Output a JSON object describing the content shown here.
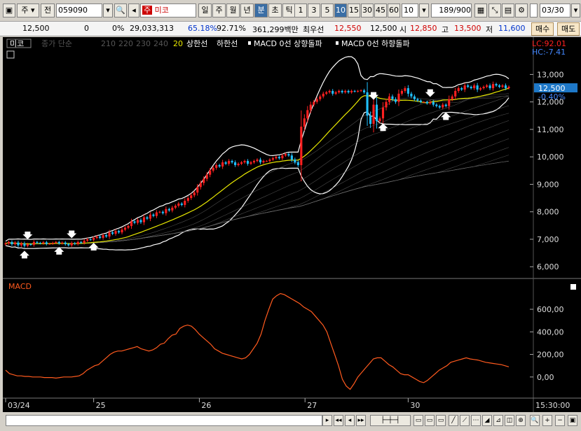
{
  "toolbar": {
    "market": "주",
    "prev_label": "전",
    "code": "059090",
    "name": "미코",
    "periods": [
      "일",
      "주",
      "월",
      "년",
      "분",
      "초",
      "틱"
    ],
    "active_period": "분",
    "intervals": [
      "1",
      "3",
      "5",
      "10",
      "15",
      "30",
      "45",
      "60"
    ],
    "active_interval": "10",
    "interval_value": "10",
    "count_value": "189",
    "count_total": "/900",
    "date": "03/30"
  },
  "quote": {
    "price": "12,500",
    "change": "0",
    "change_pct": "0%",
    "volume": "29,033,313",
    "ratio1": "65.18%",
    "ratio2": "92.71%",
    "amount": "361,299백만",
    "priority_label": "최우선",
    "priority_value": "12,550",
    "ask_value": "12,500",
    "open_label": "시",
    "open_value": "12,850",
    "high_label": "고",
    "high_value": "13,500",
    "low_label": "저",
    "low_value": "11,600",
    "buy_label": "매수",
    "sell_label": "매도"
  },
  "legend": {
    "stock_tag": "미코",
    "ma_label": "종가 단순",
    "ma_periods": [
      "210",
      "220",
      "230",
      "240"
    ],
    "ma_highlight": "20",
    "upper_label": "상한선",
    "lower_label": "하한선",
    "macd_up": "MACD 0선 상향돌파",
    "macd_down": "MACD 0선 하향돌파",
    "lc_text": "LC:92.01",
    "hc_text": "HC:-7.41",
    "current_price_tag": "12,500",
    "current_pct_tag": "-0.40%",
    "macd_title": "MACD"
  },
  "chart_data": [
    {
      "type": "candlestick",
      "panel": "price",
      "x_labels": [
        "03/24",
        "25",
        "26",
        "27",
        "30"
      ],
      "time_label": "15:30:00",
      "y_ticks": [
        6000,
        7000,
        8000,
        9000,
        10000,
        11000,
        12000,
        13000
      ],
      "y_tick_labels": [
        "6,000",
        "7,000",
        "8,000",
        "9,000",
        "10,000",
        "11,000",
        "12,000",
        "13,000"
      ],
      "ylim": [
        5700,
        13800
      ],
      "close_series": [
        6850,
        6900,
        6820,
        6880,
        6780,
        6850,
        6760,
        6820,
        6800,
        6900,
        6870,
        6850,
        6890,
        6830,
        6840,
        6870,
        6900,
        6850,
        6880,
        6820,
        6780,
        6860,
        6830,
        6900,
        6870,
        6950,
        7000,
        6980,
        7050,
        7100,
        7050,
        7150,
        7100,
        7250,
        7200,
        7300,
        7250,
        7350,
        7420,
        7480,
        7650,
        7600,
        7700,
        7620,
        7800,
        7750,
        7900,
        7850,
        7980,
        8000,
        7950,
        8100,
        8050,
        8150,
        8220,
        8300,
        8250,
        8400,
        8500,
        8600,
        8700,
        8900,
        9050,
        9200,
        9350,
        9500,
        9600,
        9700,
        9650,
        9800,
        9750,
        9850,
        9800,
        9700,
        9750,
        9800,
        9850,
        9750,
        9800,
        9850,
        9900,
        9800,
        9850,
        9850,
        9900,
        9950,
        10000,
        9950,
        10050,
        10100,
        10050,
        9900,
        9800,
        9700,
        11100,
        11400,
        11700,
        11900,
        12000,
        12100,
        12200,
        12300,
        12350,
        12400,
        12300,
        12350,
        12400,
        12350,
        12400,
        12350,
        12400,
        12380,
        12400,
        12420,
        12350,
        11500,
        11200,
        11900,
        11300,
        11400,
        11800,
        12000,
        12200,
        12100,
        12000,
        12300,
        12400,
        12500,
        12300,
        12200,
        12100,
        12050,
        12000,
        12000,
        11950,
        12000,
        11900,
        11850,
        11800,
        11900,
        11850,
        12100,
        12200,
        12400,
        12500,
        12450,
        12600,
        12550,
        12500,
        12600,
        12450,
        12500,
        12550,
        12600,
        12500,
        12650,
        12600,
        12550,
        12600,
        12500,
        12550
      ]
    },
    {
      "type": "line",
      "panel": "macd",
      "title": "MACD",
      "y_ticks": [
        0,
        200,
        400,
        600
      ],
      "y_tick_labels": [
        "0,00",
        "200,00",
        "400,00",
        "600,00"
      ],
      "ylim": [
        -150,
        780
      ],
      "series": [
        {
          "values": [
            60,
            30,
            20,
            10,
            10,
            5,
            5,
            0,
            0,
            0,
            -5,
            -5,
            -5,
            -10,
            -5,
            0,
            0,
            0,
            5,
            10,
            30,
            60,
            80,
            100,
            110,
            140,
            170,
            200,
            220,
            230,
            230,
            240,
            250,
            260,
            270,
            250,
            240,
            230,
            240,
            260,
            290,
            300,
            340,
            370,
            380,
            430,
            450,
            460,
            450,
            420,
            380,
            350,
            320,
            290,
            250,
            230,
            210,
            200,
            190,
            180,
            170,
            160,
            170,
            200,
            250,
            300,
            380,
            500,
            600,
            690,
            720,
            740,
            730,
            710,
            690,
            670,
            650,
            620,
            600,
            580,
            540,
            500,
            460,
            400,
            300,
            200,
            100,
            -20,
            -80,
            -110,
            -60,
            0,
            40,
            80,
            120,
            160,
            170,
            170,
            140,
            110,
            90,
            60,
            30,
            20,
            20,
            0,
            -20,
            -40,
            -50,
            -30,
            0,
            30,
            60,
            80,
            100,
            130,
            140,
            150,
            160,
            170,
            160,
            155,
            150,
            140,
            130,
            125,
            120,
            115,
            110,
            100,
            90
          ]
        }
      ]
    }
  ]
}
